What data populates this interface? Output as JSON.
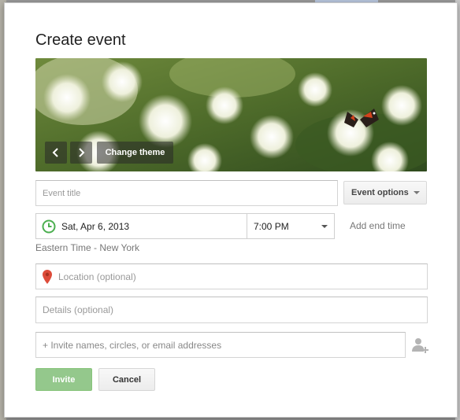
{
  "dialog": {
    "title": "Create event",
    "banner": {
      "change_theme_label": "Change theme",
      "prev_icon": "chevron-left-icon",
      "next_icon": "chevron-right-icon"
    },
    "event_title": {
      "placeholder": "Event title",
      "value": ""
    },
    "event_options_label": "Event options",
    "date": {
      "value": "Sat, Apr 6, 2013",
      "icon": "clock-icon",
      "icon_color": "#4caf50"
    },
    "time": {
      "value": "7:00 PM"
    },
    "add_end_time_label": "Add end time",
    "timezone": "Eastern Time - New York",
    "location": {
      "placeholder": "Location (optional)",
      "icon": "location-pin-icon",
      "icon_color": "#dd4b39"
    },
    "details": {
      "placeholder": "Details (optional)"
    },
    "invite": {
      "placeholder": "+ Invite names, circles, or email addresses",
      "add_icon": "add-person-icon"
    },
    "invite_button_label": "Invite",
    "cancel_button_label": "Cancel"
  },
  "colors": {
    "invite_button": "#94c88c",
    "accent_green": "#4caf50",
    "pin_red": "#dd4b39"
  }
}
